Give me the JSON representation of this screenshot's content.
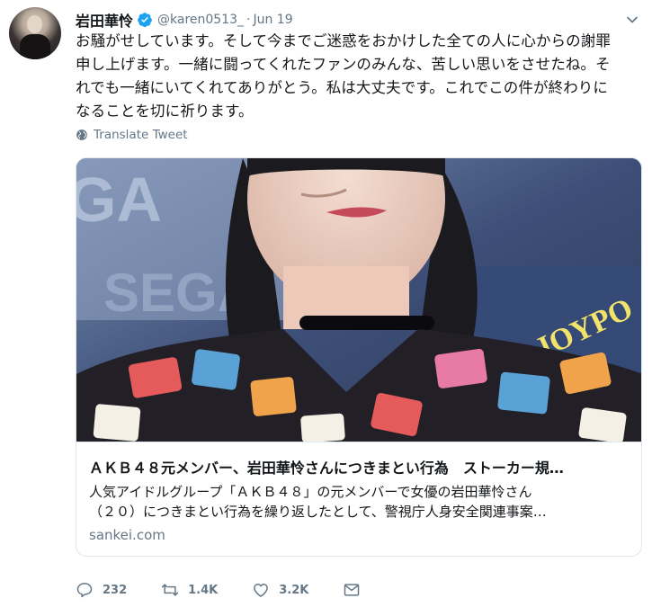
{
  "tweet": {
    "display_name": "岩田華怜",
    "handle": "@karen0513_",
    "separator": "·",
    "date": "Jun 19",
    "verified": true,
    "text_lines": [
      "お騒がせしています。そして今までご迷惑をおかけした全ての人に心からの謝罪",
      "申し上げます。一緒に闘ってくれたファンのみんな、苦しい思いをさせたね。そ",
      "れでも一緒にいてくれてありがとう。私は大丈夫です。これでこの件が終わりに",
      "なることを切に祈ります。"
    ],
    "translate_label": "Translate Tweet"
  },
  "card": {
    "title": "ＡＫＢ４８元メンバー、岩田華怜さんにつきまとい行為　ストーカー規…",
    "description_lines": [
      "人気アイドルグループ「ＡＫＢ４８」の元メンバーで女優の岩田華怜さん",
      "（２０）につきまとい行為を繰り返したとして、警視庁人身安全関連事案…"
    ],
    "domain": "sankei.com"
  },
  "actions": {
    "replies": "232",
    "retweets": "1.4K",
    "likes": "3.2K"
  },
  "icons": {
    "verified": "verified-badge-icon",
    "caret": "chevron-down-icon",
    "translate": "globe-icon",
    "reply": "reply-icon",
    "retweet": "retweet-icon",
    "like": "heart-icon",
    "dm": "envelope-icon"
  },
  "colors": {
    "verified_blue": "#1da1f2",
    "text": "#14171a",
    "secondary": "#657786",
    "border": "#e1e8ed"
  }
}
